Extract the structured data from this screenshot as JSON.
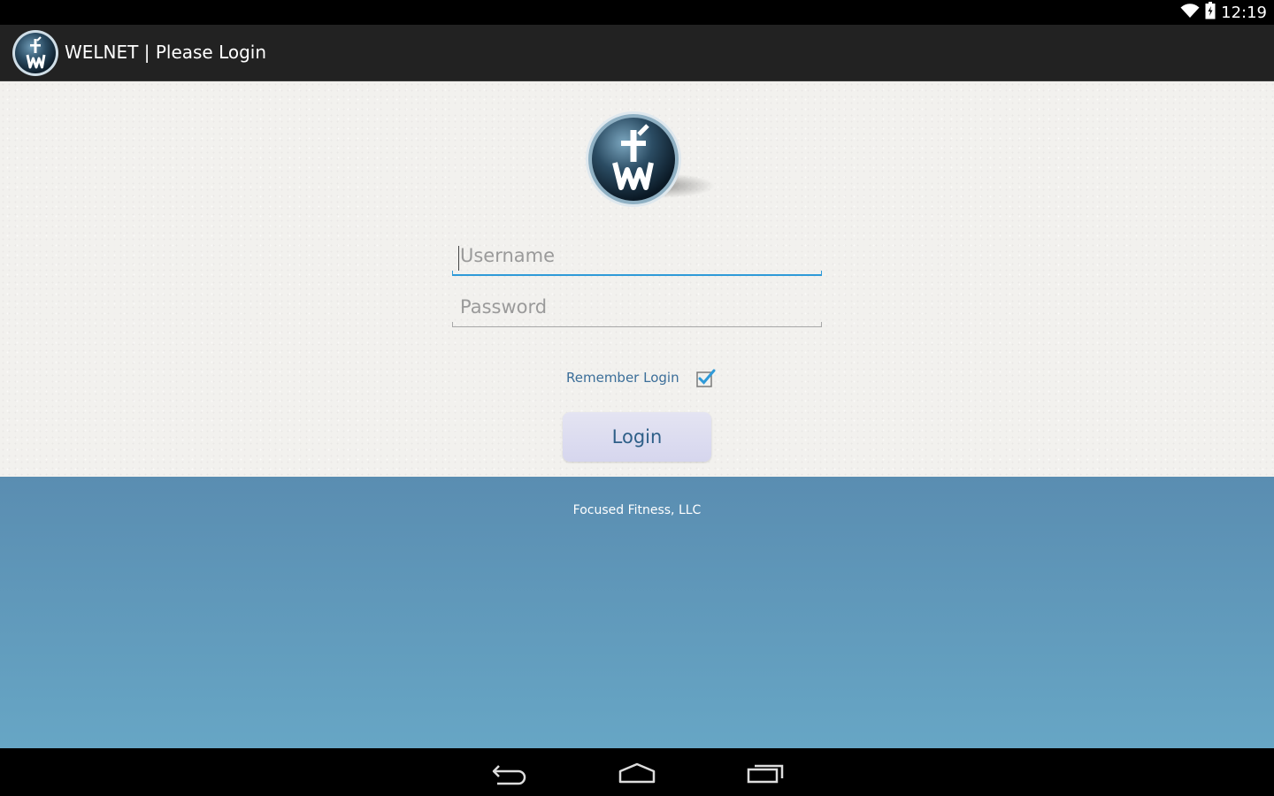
{
  "status_bar": {
    "time": "12:19",
    "icons": [
      "wifi-icon",
      "battery-icon"
    ]
  },
  "action_bar": {
    "title": "WELNET | Please Login",
    "icon": "welnet-logo-icon"
  },
  "login_form": {
    "username_placeholder": "Username",
    "username_value": "",
    "password_placeholder": "Password",
    "password_value": "",
    "remember_label": "Remember Login",
    "remember_checked": true,
    "login_button_label": "Login"
  },
  "footer": {
    "company": "Focused Fitness, LLC"
  },
  "nav_bar": {
    "buttons": [
      "back-icon",
      "home-icon",
      "recent-apps-icon"
    ]
  },
  "colors": {
    "action_bar_bg": "#222222",
    "content_bg": "#f2f1ee",
    "accent_focus": "#2f9ad8",
    "label_blue": "#3b6e99",
    "footer_top": "#5a8db1",
    "footer_bottom": "#67a6c5",
    "button_bg": "#dcdcf0"
  }
}
